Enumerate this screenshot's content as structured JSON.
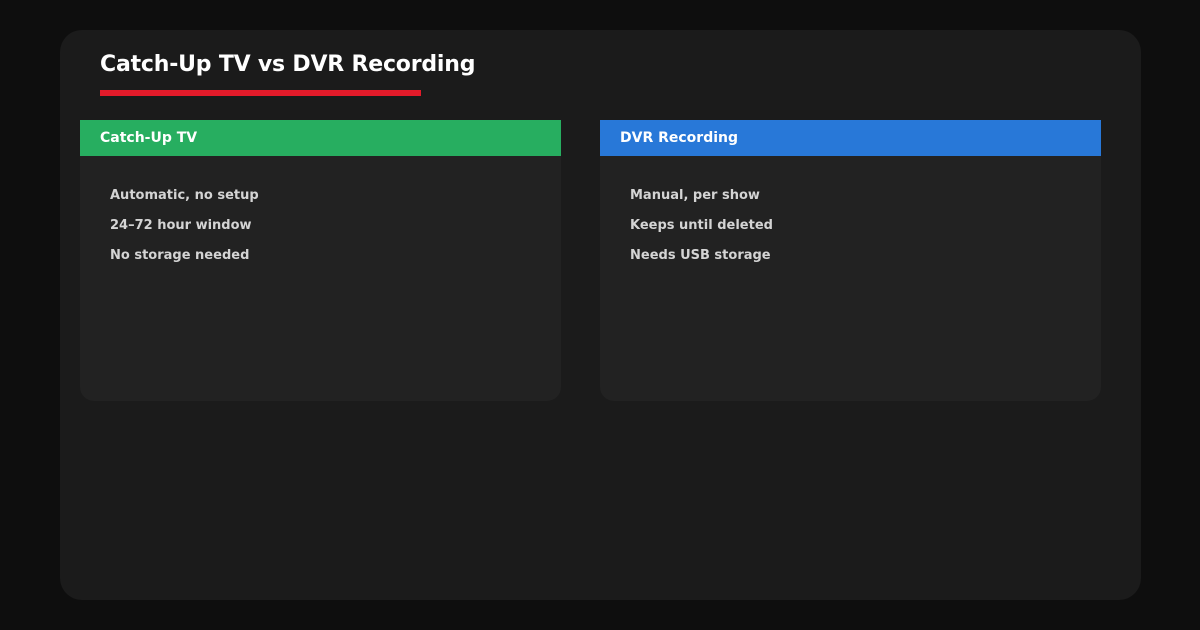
{
  "page": {
    "title": "Catch-Up TV vs DVR Recording",
    "accent_color": "#e31b2a"
  },
  "cards": [
    {
      "header": "Catch-Up TV",
      "header_color": "#27ae60",
      "items": [
        "Automatic, no setup",
        "24–72 hour window",
        "No storage needed"
      ]
    },
    {
      "header": "DVR Recording",
      "header_color": "#2878d8",
      "items": [
        "Manual, per show",
        "Keeps until deleted",
        "Needs USB storage"
      ]
    }
  ]
}
